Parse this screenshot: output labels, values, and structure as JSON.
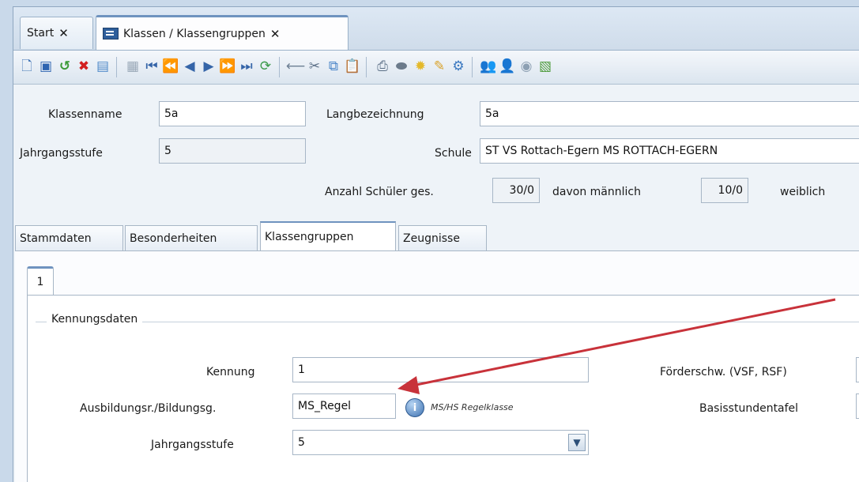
{
  "tabs": [
    {
      "label": "Start",
      "close": "✕"
    },
    {
      "label": "Klassen / Klassengruppen",
      "close": "✕"
    }
  ],
  "toolbar": {
    "icons": [
      "new-document-icon",
      "save-icon",
      "undo-icon",
      "delete-icon",
      "form-icon",
      "copy-record-icon",
      "first-record-icon",
      "fast-back-icon",
      "previous-icon",
      "next-icon",
      "fast-forward-icon",
      "last-record-icon",
      "refresh-icon",
      "remove-icon",
      "cut-icon",
      "copy-icon",
      "paste-icon",
      "print-icon",
      "preview-icon",
      "idea-icon",
      "edit-icon",
      "settings-icon",
      "users-icon",
      "user-group-icon",
      "export-icon",
      "report-icon"
    ]
  },
  "header": {
    "klassenname_label": "Klassenname",
    "klassenname_value": "5a",
    "langbezeichnung_label": "Langbezeichnung",
    "langbezeichnung_value": "5a",
    "jahrgangsstufe_label": "Jahrgangsstufe",
    "jahrgangsstufe_value": "5",
    "schule_label": "Schule",
    "schule_value": "ST VS Rottach-Egern MS ROTTACH-EGERN",
    "anzahl_label": "Anzahl Schüler ges.",
    "anzahl_value": "30/0",
    "maennlich_label": "davon männlich",
    "maennlich_value": "10/0",
    "weiblich_label": "weiblich"
  },
  "form_tabs": [
    "Stammdaten",
    "Besonderheiten",
    "Klassengruppen",
    "Zeugnisse"
  ],
  "sub_tab": "1",
  "group": {
    "title": "Kennungsdaten",
    "kennung_label": "Kennung",
    "kennung_value": "1",
    "ausbildung_label": "Ausbildungsr./Bildungsg.",
    "ausbildung_value": "MS_Regel",
    "ausbildung_hint": "MS/HS Regelklasse",
    "jahrgang_label": "Jahrgangsstufe",
    "jahrgang_value": "5",
    "foerder_label": "Förderschw. (VSF, RSF)",
    "basis_label": "Basisstundentafel"
  },
  "colors": {
    "accent": "#6f93bf",
    "annotation_arrow": "#c8323a"
  }
}
